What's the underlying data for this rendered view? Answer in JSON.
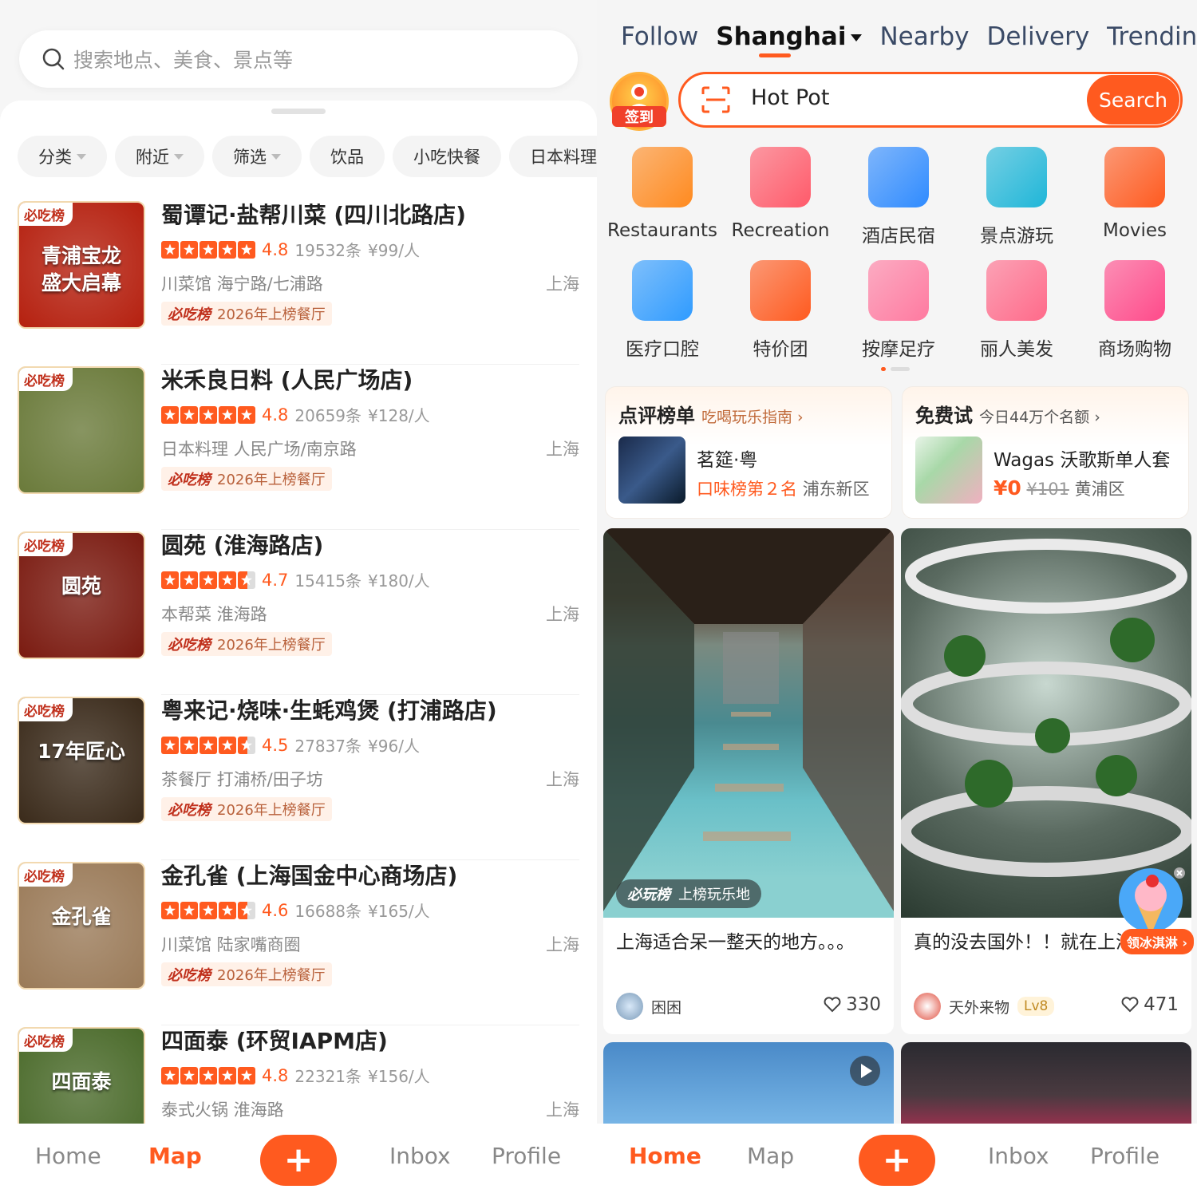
{
  "left": {
    "search_placeholder": "搜索地点、美食、景点等",
    "chips": [
      {
        "label": "分类",
        "dropdown": true
      },
      {
        "label": "附近",
        "dropdown": true
      },
      {
        "label": "筛选",
        "dropdown": true
      },
      {
        "label": "饮品",
        "dropdown": false
      },
      {
        "label": "小吃快餐",
        "dropdown": false
      },
      {
        "label": "日本料理",
        "dropdown": false
      }
    ],
    "restaurants": [
      {
        "name": "蜀谭记·盐帮川菜 (四川北路店)",
        "rating": "4.8",
        "stars": 5,
        "reviews": "19532条",
        "price": "¥99/人",
        "category": "川菜馆 海宁路/七浦路",
        "city": "上海",
        "badge_logo": "必吃榜",
        "badge_text": "2026年上榜餐厅",
        "thumb_tag": "必吃榜",
        "thumb_text": "青浦宝龙\n盛大启幕",
        "thumb_color": "#b5200f"
      },
      {
        "name": "米禾良日料 (人民广场店)",
        "rating": "4.8",
        "stars": 5,
        "reviews": "20659条",
        "price": "¥128/人",
        "category": "日本料理 人民广场/南京路",
        "city": "上海",
        "badge_logo": "必吃榜",
        "badge_text": "2026年上榜餐厅",
        "thumb_tag": "必吃榜",
        "thumb_text": "",
        "thumb_color": "#6a7a3a"
      },
      {
        "name": "圆苑 (淮海路店)",
        "rating": "4.7",
        "stars": 4.5,
        "reviews": "15415条",
        "price": "¥180/人",
        "category": "本帮菜 淮海路",
        "city": "上海",
        "badge_logo": "必吃榜",
        "badge_text": "2026年上榜餐厅",
        "thumb_tag": "必吃榜",
        "thumb_text": "圆苑",
        "thumb_color": "#7a1a10"
      },
      {
        "name": "粤来记·烧味·生蚝鸡煲 (打浦路店)",
        "rating": "4.5",
        "stars": 4.5,
        "reviews": "27837条",
        "price": "¥96/人",
        "category": "茶餐厅 打浦桥/田子坊",
        "city": "上海",
        "badge_logo": "必吃榜",
        "badge_text": "2026年上榜餐厅",
        "thumb_tag": "必吃榜",
        "thumb_text": "17年匠心",
        "thumb_color": "#3a2a1a"
      },
      {
        "name": "金孔雀 (上海国金中心商场店)",
        "rating": "4.6",
        "stars": 4.5,
        "reviews": "16688条",
        "price": "¥165/人",
        "category": "川菜馆 陆家嘴商圈",
        "city": "上海",
        "badge_logo": "必吃榜",
        "badge_text": "2026年上榜餐厅",
        "thumb_tag": "必吃榜",
        "thumb_text": "金孔雀",
        "thumb_color": "#9a7a58"
      },
      {
        "name": "四面泰 (环贸IAPM店)",
        "rating": "4.8",
        "stars": 5,
        "reviews": "22321条",
        "price": "¥156/人",
        "category": "泰式火锅 淮海路",
        "city": "上海",
        "badge_logo": "",
        "badge_text": "",
        "thumb_tag": "必吃榜",
        "thumb_text": "四面泰",
        "thumb_color": "#4a6a2a"
      }
    ],
    "nav": {
      "home": "Home",
      "map": "Map",
      "plus": "+",
      "inbox": "Inbox",
      "profile": "Profile",
      "active": "map"
    }
  },
  "right": {
    "tabs": [
      "Follow",
      "Shanghai",
      "Nearby",
      "Delivery",
      "Trendin"
    ],
    "active_tab": "Shanghai",
    "checkin_label": "签到",
    "search_value": "Hot Pot",
    "search_button": "Search",
    "categories": [
      {
        "label": "Restaurants",
        "icon": "roast-chicken-icon",
        "color": "#ff8a1f"
      },
      {
        "label": "Recreation",
        "icon": "recreation-icon",
        "color": "#ff5a6a"
      },
      {
        "label": "酒店民宿",
        "icon": "hotel-icon",
        "color": "#2f8bff"
      },
      {
        "label": "景点游玩",
        "icon": "palm-tree-icon",
        "color": "#1fb6d8"
      },
      {
        "label": "Movies",
        "icon": "cat-mask-icon",
        "color": "#ff5a1f"
      },
      {
        "label": "医疗口腔",
        "icon": "medical-icon",
        "color": "#2f9bff"
      },
      {
        "label": "特价团",
        "icon": "discount-icon",
        "color": "#ff5a1f"
      },
      {
        "label": "按摩足疗",
        "icon": "massage-icon",
        "color": "#ff7aa0"
      },
      {
        "label": "丽人美发",
        "icon": "beauty-icon",
        "color": "#ff6a8a"
      },
      {
        "label": "商场购物",
        "icon": "shopping-bag-icon",
        "color": "#ff4a8a"
      }
    ],
    "card_left": {
      "title": "点评榜单",
      "subtitle": "吃喝玩乐指南 ›",
      "item_name": "茗筵·粤",
      "rank": "口味榜第２名",
      "district": "浦东新区"
    },
    "card_right": {
      "title": "免费试",
      "subtitle": "今日44万个名额 ›",
      "item_name": "Wagas 沃歌斯单人套",
      "price": "¥0",
      "orig_price": "¥101",
      "district": "黄浦区"
    },
    "posts": [
      {
        "tag_logo": "必玩榜",
        "tag_text": "上榜玩乐地",
        "caption": "上海适合呆一整天的地方。。。",
        "user": "困困",
        "level": "",
        "likes": "330"
      },
      {
        "tag_logo": "",
        "tag_text": "",
        "caption": "真的没去国外！！就在上海！",
        "user": "天外来物",
        "level": "Lv8",
        "likes": "471"
      }
    ],
    "ice_button": "领冰淇淋 ›",
    "nav": {
      "home": "Home",
      "map": "Map",
      "plus": "+",
      "inbox": "Inbox",
      "profile": "Profile",
      "active": "home"
    }
  }
}
